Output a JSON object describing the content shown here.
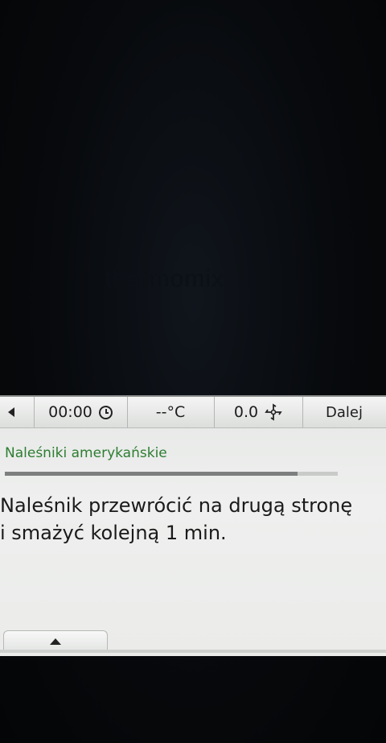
{
  "brand": {
    "text": "thermomix"
  },
  "statusbar": {
    "time": "00:00",
    "temperature": "--°C",
    "speed": "0.0",
    "next_label": "Dalej"
  },
  "recipe": {
    "title": "Naleśniki amerykańskie",
    "progress": 0.88
  },
  "instruction": {
    "line1": "Naleśnik przewrócić na drugą stronę",
    "line2": "i smażyć kolejną 1 min."
  },
  "icons": {
    "back": "back-arrow-icon",
    "time": "clock-icon",
    "speed": "fan-icon",
    "expand": "chevron-up-icon"
  }
}
